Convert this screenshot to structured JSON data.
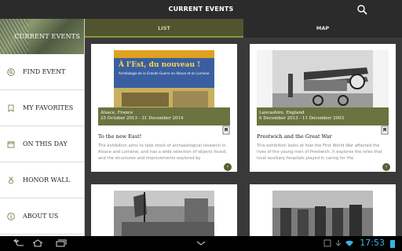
{
  "app": {
    "title": "CURRENT EVENTS"
  },
  "sidebar": {
    "header_label": "CURRENT EVENTS",
    "items": [
      {
        "label": "FIND EVENT",
        "icon": "search-icon"
      },
      {
        "label": "MY FAVORITES",
        "icon": "bookmark-icon"
      },
      {
        "label": "ON THIS DAY",
        "icon": "calendar-icon"
      },
      {
        "label": "HONOR WALL",
        "icon": "medal-icon"
      },
      {
        "label": "ABOUT US",
        "icon": "info-icon"
      }
    ]
  },
  "tabs": {
    "list": "LIST",
    "map": "MAP",
    "selected": "LIST"
  },
  "cards": [
    {
      "poster_title": "À l'Est, du nouveau !",
      "poster_sub": "Archéologie de la Grande Guerre en Alsace et en Lorraine",
      "location": "Alsace, France",
      "dates": "25 October 2013 - 31 December 2014",
      "title": "To the new East!",
      "description": "The exhibition aims to take stock of archaeological research in Alsace and Lorraine, and has a wide selection of objects found, and the structures and improvements explored by"
    },
    {
      "location": "Lancashire, England",
      "dates": "6 December 2013 - 11 December 2003",
      "title": "Prestwich and the Great War",
      "description": "This exhibition looks at how the First World War affected the lives of the young men of Prestwich. It explores the roles that local auxiliary hospitals played in caring for the"
    }
  ],
  "status": {
    "time": "17:53"
  },
  "colors": {
    "accent": "#6b7340",
    "tab_bg": "#50552f",
    "clock": "#35b5e5"
  }
}
